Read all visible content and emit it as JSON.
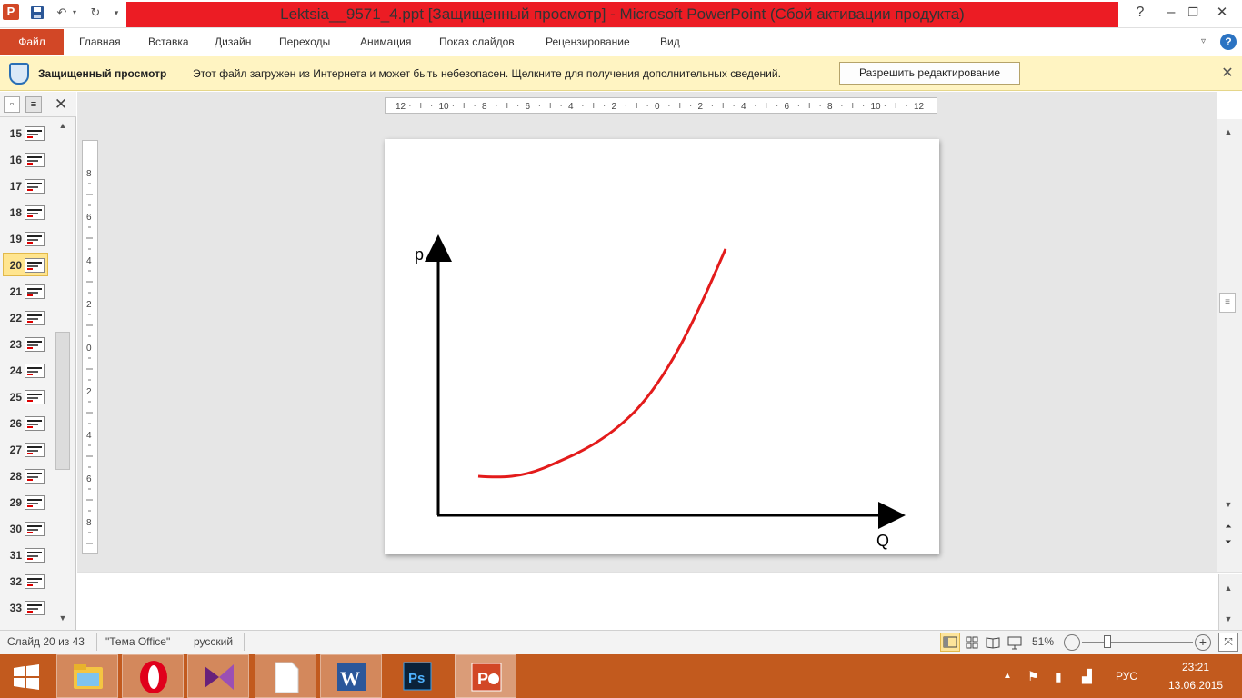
{
  "window": {
    "title": "Lektsia__9571_4.ppt [Защищенный просмотр] - Microsoft PowerPoint (Сбой активации продукта)",
    "app_icon_letter": "P"
  },
  "ribbon": {
    "file_tab": "Файл",
    "tabs": [
      "Главная",
      "Вставка",
      "Дизайн",
      "Переходы",
      "Анимация",
      "Показ слайдов",
      "Рецензирование",
      "Вид"
    ]
  },
  "protected_view": {
    "title": "Защищенный просмотр",
    "message": "Этот файл загружен из Интернета и может быть небезопасен. Щелкните для получения дополнительных сведений.",
    "enable_button": "Разрешить редактирование"
  },
  "slides_panel": {
    "numbers": [
      "15",
      "16",
      "17",
      "18",
      "19",
      "20",
      "21",
      "22",
      "23",
      "24",
      "25",
      "26",
      "27",
      "28",
      "29",
      "30",
      "31",
      "32",
      "33"
    ],
    "selected": "20"
  },
  "ruler": {
    "horizontal_labels": [
      "12",
      "10",
      "8",
      "6",
      "4",
      "2",
      "0",
      "2",
      "4",
      "6",
      "8",
      "10",
      "12"
    ],
    "vertical_labels": [
      "8",
      "6",
      "4",
      "2",
      "0",
      "2",
      "4",
      "6",
      "8"
    ]
  },
  "slide": {
    "y_axis_label": "p",
    "x_axis_label": "Q",
    "curve_color": "#e31b1b",
    "axis_color": "#000000"
  },
  "status": {
    "slide_info": "Слайд 20 из 43",
    "theme": "\"Тема Office\"",
    "language": "русский",
    "zoom": "51%"
  },
  "taskbar": {
    "language": "РУС",
    "time": "23:21",
    "date": "13.06.2015"
  },
  "colors": {
    "accent": "#d24726",
    "title_highlight": "#ec1c24",
    "taskbar": "#c25a1e",
    "protected_bar": "#fff4c2"
  }
}
